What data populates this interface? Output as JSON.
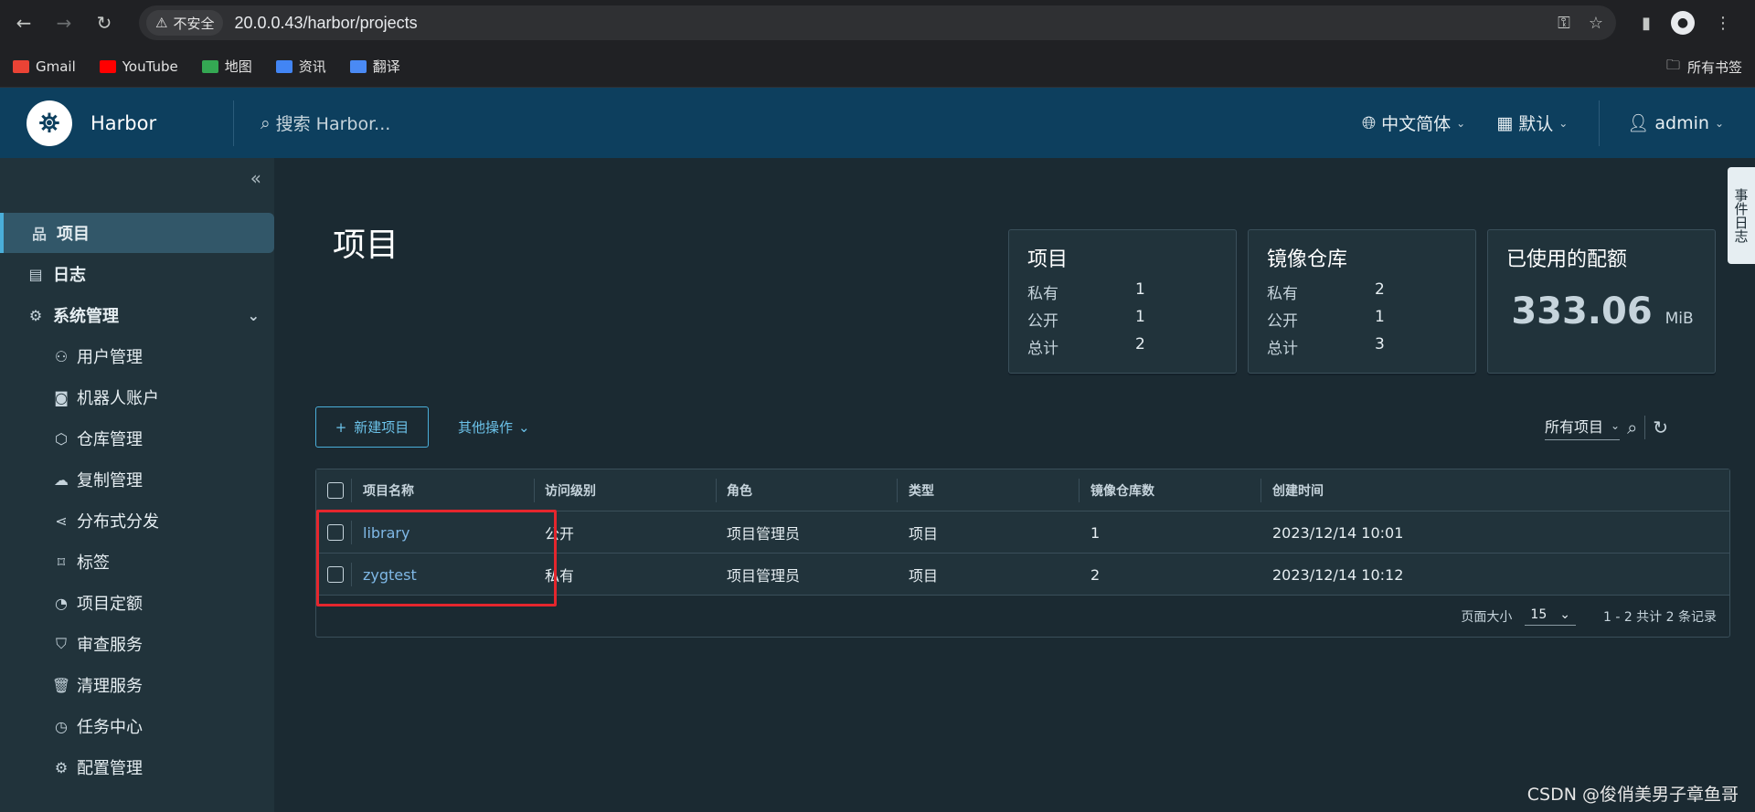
{
  "browser": {
    "security_label": "不安全",
    "url": "20.0.0.43/harbor/projects",
    "bookmarks": [
      "Gmail",
      "YouTube",
      "地图",
      "资讯",
      "翻译"
    ],
    "bookmarks_folder": "所有书签"
  },
  "header": {
    "brand": "Harbor",
    "search_placeholder": "搜索 Harbor...",
    "language": "中文简体",
    "theme": "默认",
    "user": "admin"
  },
  "sidebar": {
    "items": [
      {
        "label": "项目",
        "icon": "project-icon"
      },
      {
        "label": "日志",
        "icon": "log-icon"
      },
      {
        "label": "系统管理",
        "icon": "admin-icon"
      },
      {
        "label": "用户管理",
        "icon": "users-icon"
      },
      {
        "label": "机器人账户",
        "icon": "robot-icon"
      },
      {
        "label": "仓库管理",
        "icon": "box-icon"
      },
      {
        "label": "复制管理",
        "icon": "cloud-icon"
      },
      {
        "label": "分布式分发",
        "icon": "share-icon"
      },
      {
        "label": "标签",
        "icon": "tag-icon"
      },
      {
        "label": "项目定额",
        "icon": "gauge-icon"
      },
      {
        "label": "审查服务",
        "icon": "shield-icon"
      },
      {
        "label": "清理服务",
        "icon": "trash-icon"
      },
      {
        "label": "任务中心",
        "icon": "dashboard-icon"
      },
      {
        "label": "配置管理",
        "icon": "gear-icon"
      }
    ]
  },
  "main": {
    "title": "项目",
    "cards": {
      "projects": {
        "title": "项目",
        "rows": [
          {
            "label": "私有",
            "value": "1"
          },
          {
            "label": "公开",
            "value": "1"
          },
          {
            "label": "总计",
            "value": "2"
          }
        ]
      },
      "repos": {
        "title": "镜像仓库",
        "rows": [
          {
            "label": "私有",
            "value": "2"
          },
          {
            "label": "公开",
            "value": "1"
          },
          {
            "label": "总计",
            "value": "3"
          }
        ]
      },
      "quota": {
        "title": "已使用的配额",
        "value": "333.06",
        "unit": "MiB"
      }
    },
    "new_project": "新建项目",
    "other_ops": "其他操作",
    "filter": "所有项目",
    "table": {
      "headers": [
        "项目名称",
        "访问级别",
        "角色",
        "类型",
        "镜像仓库数",
        "创建时间"
      ],
      "rows": [
        [
          "library",
          "公开",
          "项目管理员",
          "项目",
          "1",
          "2023/12/14 10:01"
        ],
        [
          "zygtest",
          "私有",
          "项目管理员",
          "项目",
          "2",
          "2023/12/14 10:12"
        ]
      ],
      "page_size_label": "页面大小",
      "page_size": "15",
      "summary": "1 - 2 共计 2 条记录"
    }
  },
  "side_tab": "事件日志",
  "watermark": "CSDN @俊俏美男子章鱼哥",
  "colors": {
    "accent": "#4aaed9",
    "header_bg": "#0d3f5e",
    "highlight_box": "#e5262d"
  }
}
